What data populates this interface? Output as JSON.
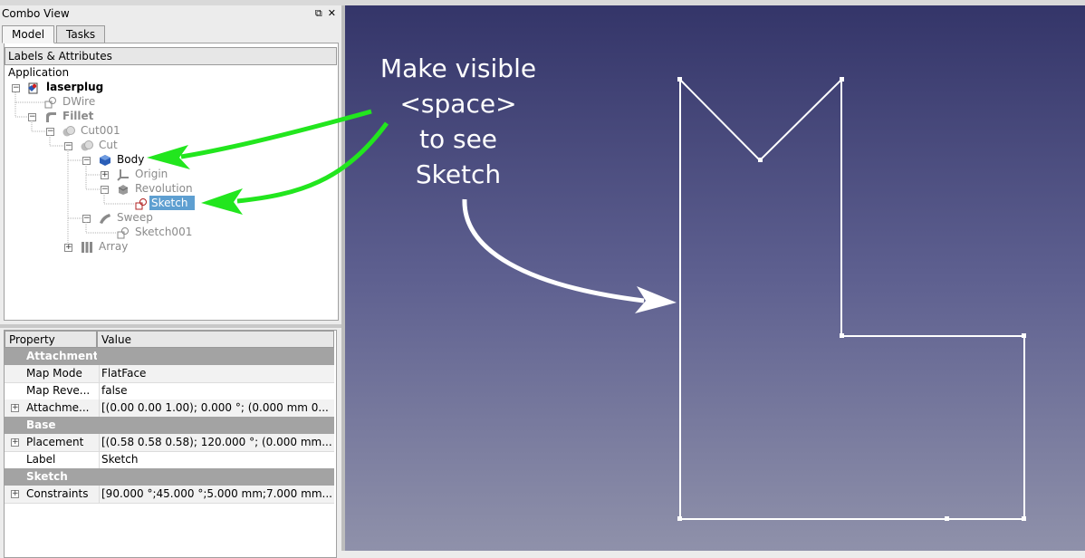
{
  "panel": {
    "title": "Combo View",
    "tabs": [
      "Model",
      "Tasks"
    ],
    "labels_header": "Labels & Attributes",
    "root": "Application"
  },
  "tree": [
    {
      "label": "laserplug"
    },
    {
      "label": "DWire"
    },
    {
      "label": "Fillet"
    },
    {
      "label": "Cut001"
    },
    {
      "label": "Cut"
    },
    {
      "label": "Body"
    },
    {
      "label": "Origin"
    },
    {
      "label": "Revolution"
    },
    {
      "label": "Sketch"
    },
    {
      "label": "Sweep"
    },
    {
      "label": "Sketch001"
    },
    {
      "label": "Array"
    }
  ],
  "properties": {
    "header": {
      "property": "Property",
      "value": "Value"
    },
    "rows": [
      {
        "group": "Attachment"
      },
      {
        "name": "Map Mode",
        "value": "FlatFace"
      },
      {
        "name": "Map Reve...",
        "value": "false"
      },
      {
        "name": "Attachme...",
        "value": "[(0.00 0.00 1.00); 0.000 °; (0.000 mm  0..."
      },
      {
        "group": "Base"
      },
      {
        "name": "Placement",
        "value": "[(0.58 0.58 0.58); 120.000 °; (0.000 mm..."
      },
      {
        "name": "Label",
        "value": "Sketch"
      },
      {
        "group": "Sketch"
      },
      {
        "name": "Constraints",
        "value": "[90.000 °;45.000 °;5.000 mm;7.000 mm..."
      }
    ]
  },
  "annotation": {
    "lines": [
      "Make visible",
      "<space>",
      "to see",
      "Sketch"
    ]
  },
  "colors": {
    "arrow_green": "#22e61e",
    "viewport_top": "#343569",
    "viewport_bottom": "#8f91aa",
    "selection": "#5e9fd1"
  }
}
